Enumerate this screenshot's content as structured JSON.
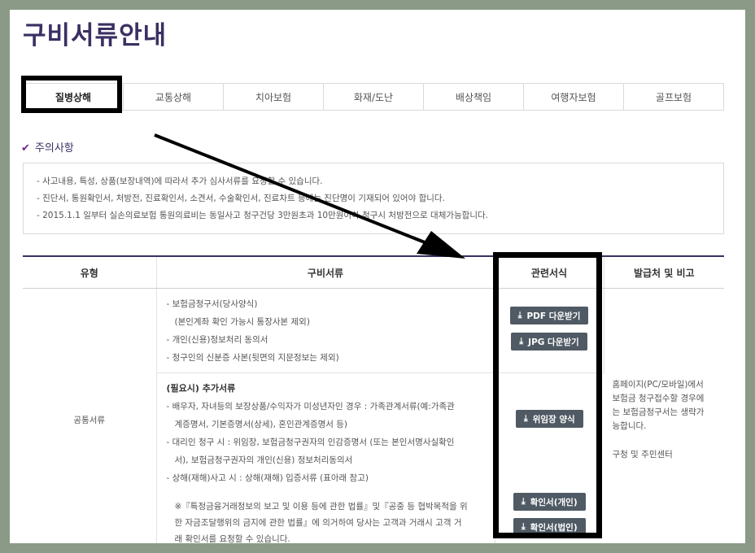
{
  "page": {
    "title": "구비서류안내"
  },
  "tabs": [
    {
      "label": "질병상해",
      "active": true
    },
    {
      "label": "교통상해"
    },
    {
      "label": "치아보험"
    },
    {
      "label": "화재/도난"
    },
    {
      "label": "배상책임"
    },
    {
      "label": "여행자보험"
    },
    {
      "label": "골프보험"
    }
  ],
  "notice": {
    "heading": "주의사항",
    "items": [
      "- 사고내용, 특성, 상품(보장내역)에 따라서 추가 심사서류를 요청할 수 있습니다.",
      "- 진단서, 통원확인서, 처방전, 진료확인서, 소견서, 수술확인서, 진료차트 등에는 진단명이 기재되어 있어야 합니다.",
      "- 2015.1.1 일부터 실손의료보험 통원의료비는 동일사고 청구건당 3만원초과 10만원이하 청구시 처방전으로 대체가능합니다."
    ]
  },
  "table": {
    "headers": [
      "유형",
      "구비서류",
      "관련서식",
      "발급처 및 비고"
    ],
    "type_label": "공통서류",
    "basic_docs": [
      "- 보험금청구서(당사양식)",
      "(본인계좌 확인 가능시 통장사본 제외)",
      "- 개인(신용)정보처리 동의서",
      "- 청구인의 신분증 사본(뒷면의 지문정보는 제외)"
    ],
    "additional_title": "(필요시) 추가서류",
    "additional_docs": [
      "- 배우자, 자녀등의 보장상품/수익자가 미성년자인 경우 : 가족관계서류(예:가족관",
      "계증명서, 기본증명서(상세), 혼인관계증명서 등)",
      "- 대리인 청구 시 : 위임장, 보험금청구권자의 인감증명서 (또는 본인서명사실확인",
      "서), 보험금청구권자의 개인(신용) 정보처리동의서",
      "- 상해(재해)사고 시 : 상해(재해) 입증서류 (표아래 참고)"
    ],
    "note_lines": [
      "※『특정금융거래정보의 보고 및 이용 등에 관한 법률』및『공중 등 협박목적을 위",
      "한 자금조달행위의 금지에 관한 법률』에 의거하여 당사는 고객과 거래시 고객 거",
      "래 확인서를 요청할 수 있습니다."
    ],
    "buttons": {
      "pdf": "PDF 다운받기",
      "jpg": "JPG 다운받기",
      "proxy": "위임장 양식",
      "confirm_personal": "확인서(개인)",
      "confirm_corp": "확인서(법인)"
    },
    "issue_lines": [
      "홈페이지(PC/모바일)에서",
      "보험금 청구접수할 경우에",
      "는 보험금청구서는 생략가",
      "능합니다."
    ],
    "issue_extra": "구청 및 주민센터"
  },
  "icons": {
    "download": "download-icon",
    "check": "check-icon"
  },
  "colors": {
    "title": "#3b2f63",
    "button": "#4f5a64",
    "accent": "#6b2a8f",
    "frame": "#8a9a86"
  }
}
